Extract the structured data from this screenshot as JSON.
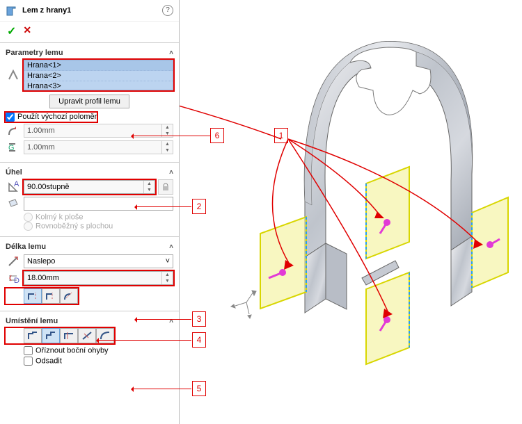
{
  "header": {
    "title": "Lem z hrany1",
    "help": "?"
  },
  "sections": {
    "parametry": {
      "title": "Parametry lemu",
      "edges": [
        "Hrana<1>",
        "Hrana<2>",
        "Hrana<3>"
      ],
      "editProfile": "Upravit profil lemu",
      "defaultRadius": "Použít výchozí poloměr",
      "radius1": "1.00mm",
      "radius2": "1.00mm"
    },
    "uhel": {
      "title": "Úhel",
      "angle": "90.00stupně",
      "direction": "",
      "perpendicular": "Kolmý k ploše",
      "parallel": "Rovnoběžný s plochou"
    },
    "delka": {
      "title": "Délka lemu",
      "type": "Naslepo",
      "length": "18.00mm"
    },
    "umisteni": {
      "title": "Umístění lemu",
      "trimSide": "Oříznout boční ohyby",
      "offset": "Odsadit"
    }
  },
  "annotations": {
    "n1": "1",
    "n2": "2",
    "n3": "3",
    "n4": "4",
    "n5": "5",
    "n6": "6"
  }
}
